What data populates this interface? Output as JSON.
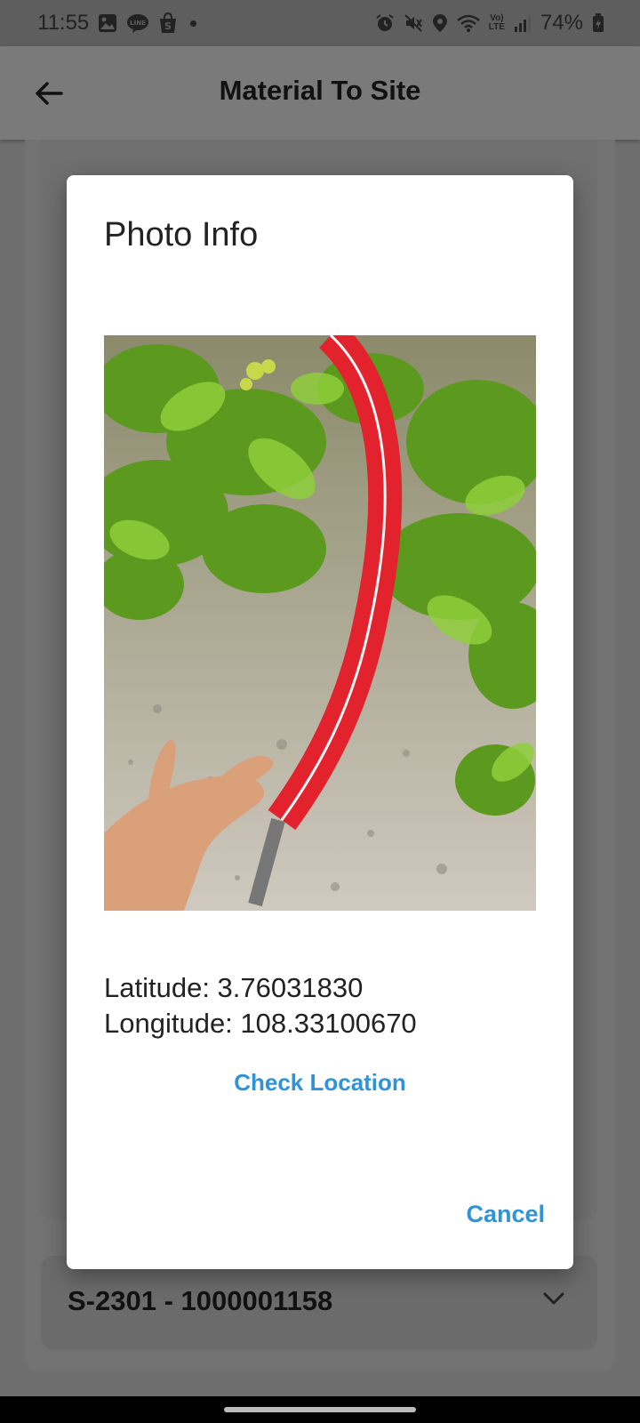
{
  "status_bar": {
    "time": "11:55",
    "battery": "74%",
    "volte_label": "Vo)\nLTE",
    "left_icons": [
      "gallery-icon",
      "line-app-icon",
      "shopee-icon",
      "dot-icon"
    ],
    "right_icons": [
      "alarm-icon",
      "mute-icon",
      "location-icon",
      "wifi-icon",
      "volte-icon",
      "signal-icon",
      "battery-icon"
    ]
  },
  "app_bar": {
    "title": "Material To Site",
    "back_icon": "arrow-left-icon"
  },
  "background": {
    "card_title": "S-2301 - 1000001158",
    "chevron_icon": "chevron-down-icon"
  },
  "dialog": {
    "title": "Photo Info",
    "latitude": "Latitude: 3.76031830",
    "longitude": "Longitude: 108.33100670",
    "check_location_label": "Check Location",
    "cancel_label": "Cancel"
  },
  "colors": {
    "accent": "#2f93d8",
    "scrim": "#6e6e6e",
    "dialog_bg": "#ffffff",
    "pipe_red": "#e2232e"
  }
}
